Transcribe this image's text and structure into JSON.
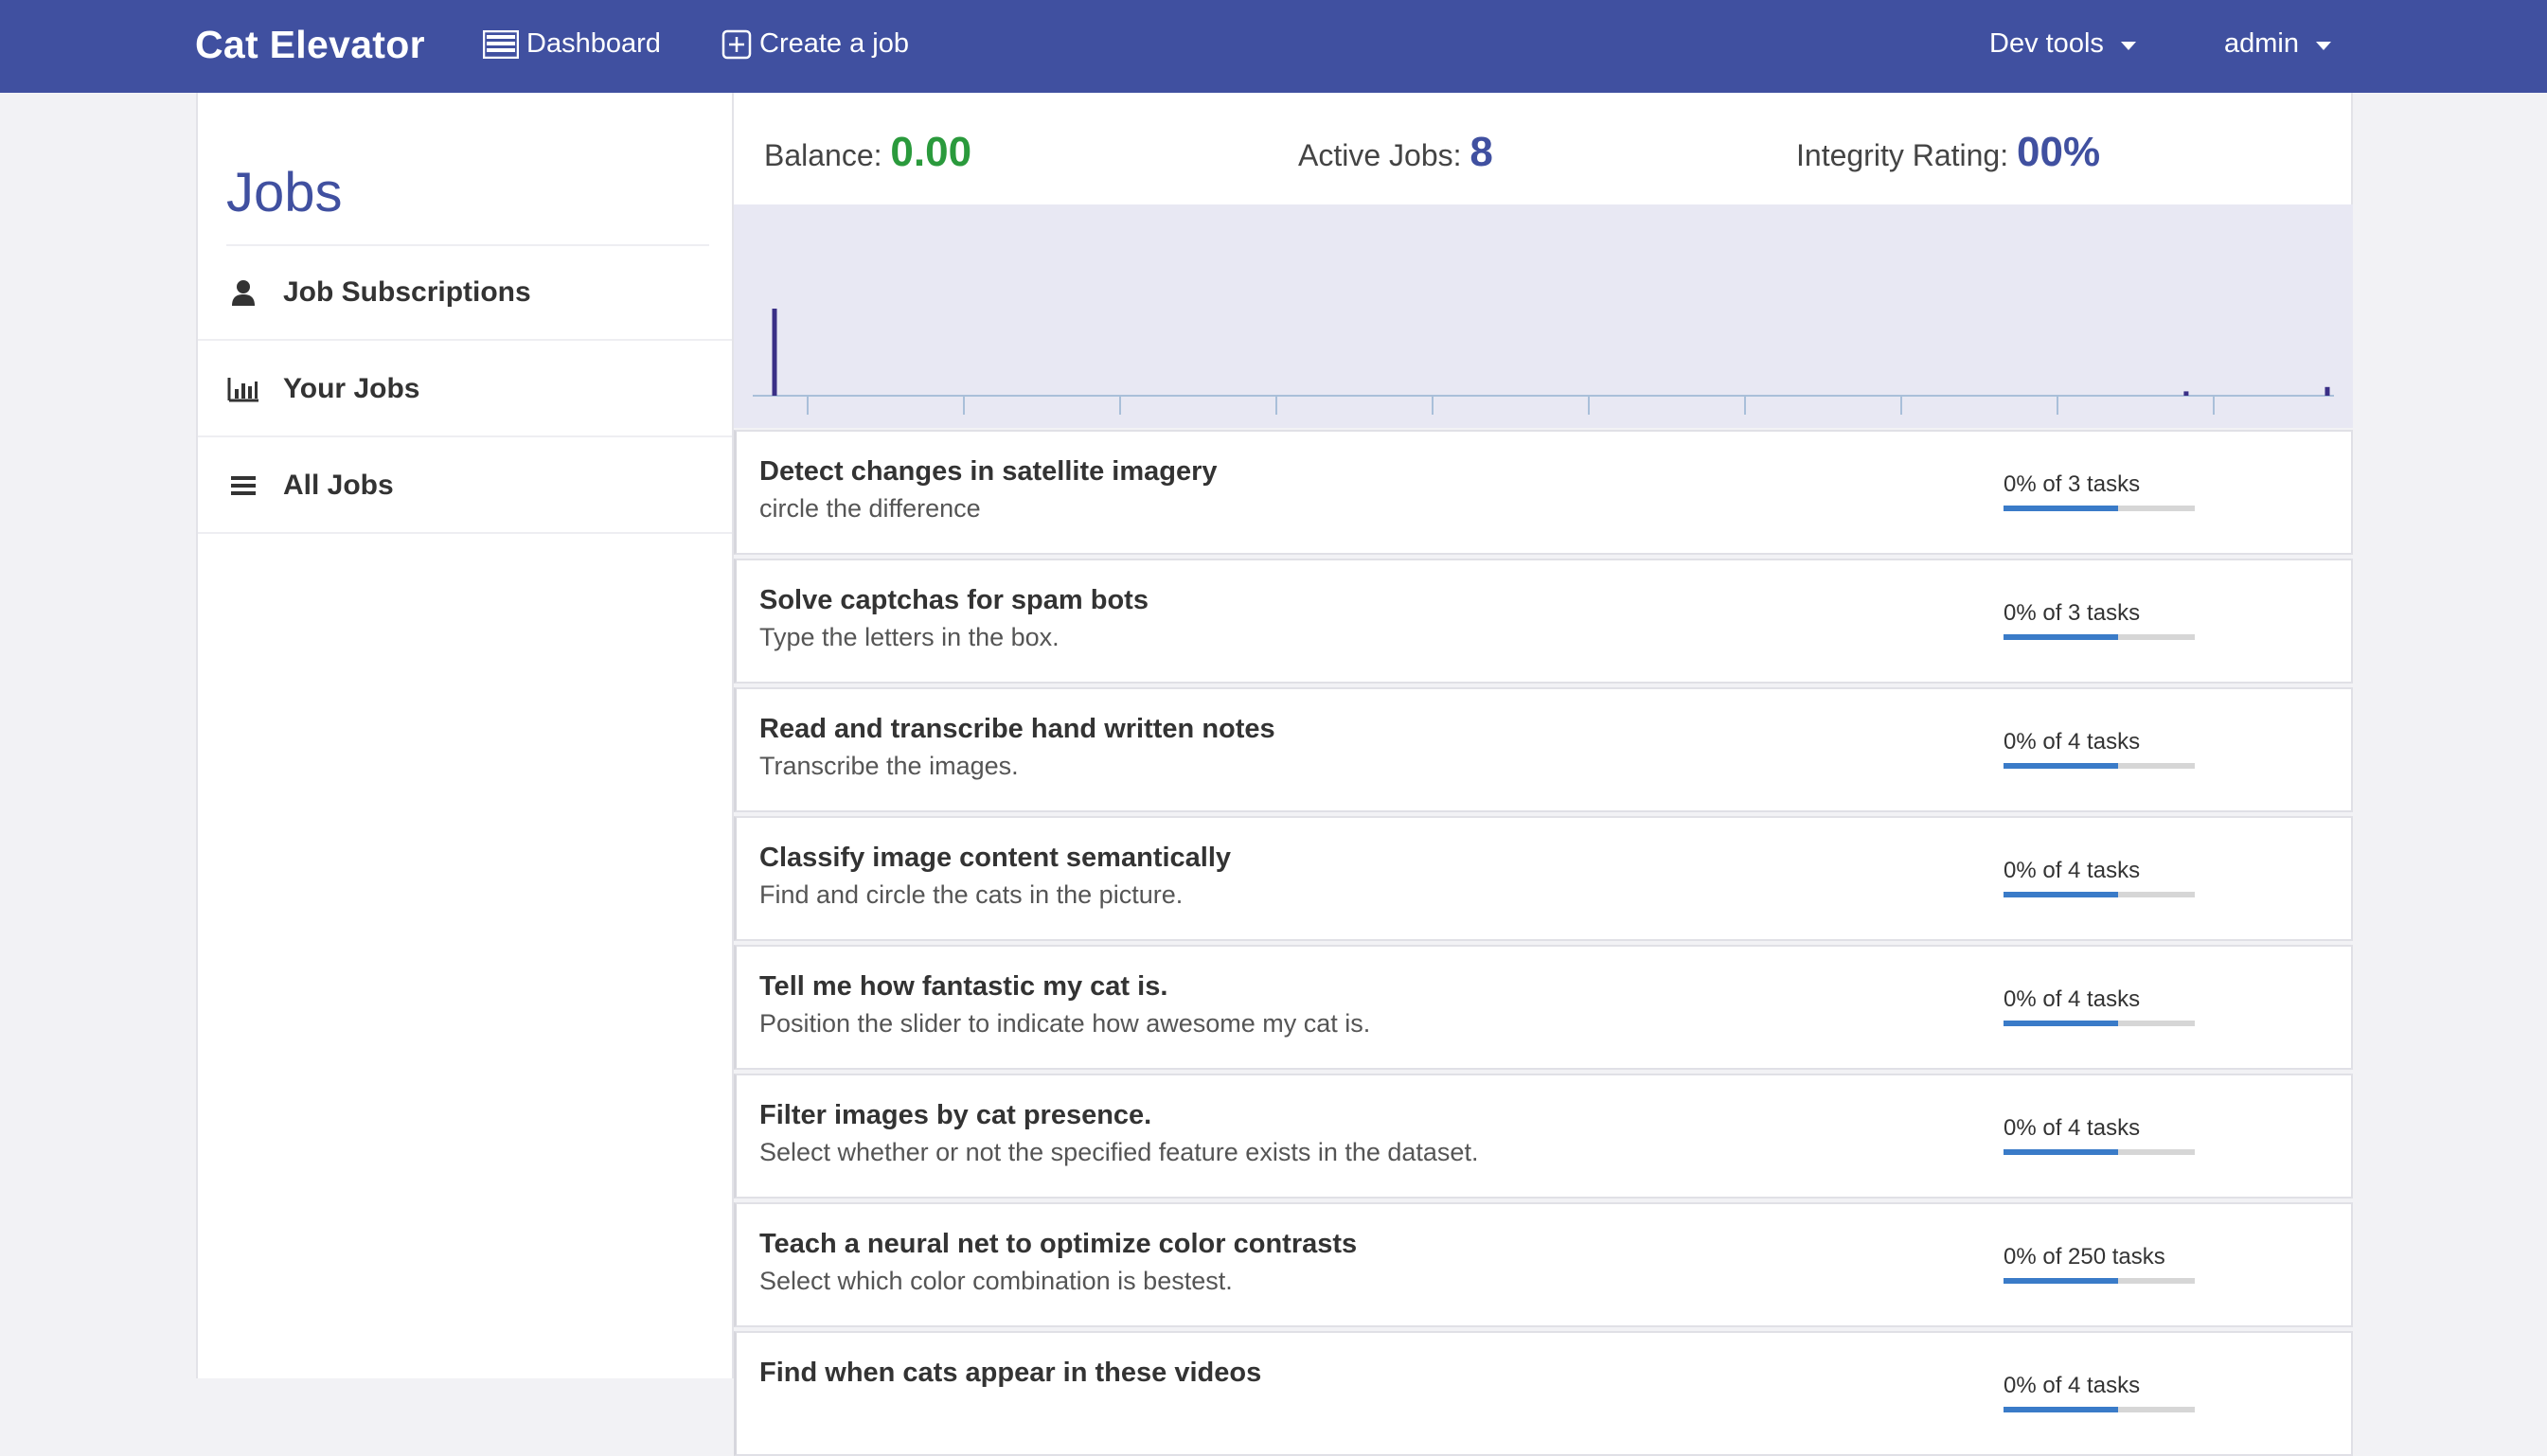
{
  "nav": {
    "brand": "Cat Elevator",
    "dashboard": "Dashboard",
    "create_job": "Create a job",
    "dev_tools": "Dev tools",
    "admin": "admin"
  },
  "sidebar": {
    "title": "Jobs",
    "items": [
      {
        "label": "Job Subscriptions",
        "icon": "user-icon"
      },
      {
        "label": "Your Jobs",
        "icon": "bar-chart-icon"
      },
      {
        "label": "All Jobs",
        "icon": "list-icon"
      }
    ]
  },
  "stats": {
    "balance_label": "Balance:",
    "balance_value": "0.00",
    "active_label": "Active Jobs:",
    "active_value": "8",
    "integrity_label": "Integrity Rating:",
    "integrity_value": "00%"
  },
  "chart_data": {
    "type": "bar",
    "values": [
      1.0,
      0,
      0,
      0,
      0,
      0,
      0,
      0,
      0,
      0,
      0.05,
      0.1
    ],
    "grid": false,
    "colors": {
      "bar": "#3a2f86",
      "axis": "#a9bfd9",
      "background": "#e8e8f3"
    }
  },
  "jobs": [
    {
      "title": "Detect changes in satellite imagery",
      "desc": "circle the difference",
      "progress": "0% of 3 tasks",
      "fill": 0.6
    },
    {
      "title": "Solve captchas for spam bots",
      "desc": "Type the letters in the box.",
      "progress": "0% of 3 tasks",
      "fill": 0.6
    },
    {
      "title": "Read and transcribe hand written notes",
      "desc": "Transcribe the images.",
      "progress": "0% of 4 tasks",
      "fill": 0.6
    },
    {
      "title": "Classify image content semantically",
      "desc": "Find and circle the cats in the picture.",
      "progress": "0% of 4 tasks",
      "fill": 0.6
    },
    {
      "title": "Tell me how fantastic my cat is.",
      "desc": "Position the slider to indicate how awesome my cat is.",
      "progress": "0% of 4 tasks",
      "fill": 0.6
    },
    {
      "title": "Filter images by cat presence.",
      "desc": "Select whether or not the specified feature exists in the dataset.",
      "progress": "0% of 4 tasks",
      "fill": 0.6
    },
    {
      "title": "Teach a neural net to optimize color contrasts",
      "desc": "Select which color combination is bestest.",
      "progress": "0% of 250 tasks",
      "fill": 0.6
    },
    {
      "title": "Find when cats appear in these videos",
      "desc": "",
      "progress": "0% of 4 tasks",
      "fill": 0.6
    }
  ],
  "colors": {
    "navbar": "#4050a0",
    "accent": "#4050a0",
    "balance": "#2a9a3c",
    "progress": "#3a7bc8"
  }
}
